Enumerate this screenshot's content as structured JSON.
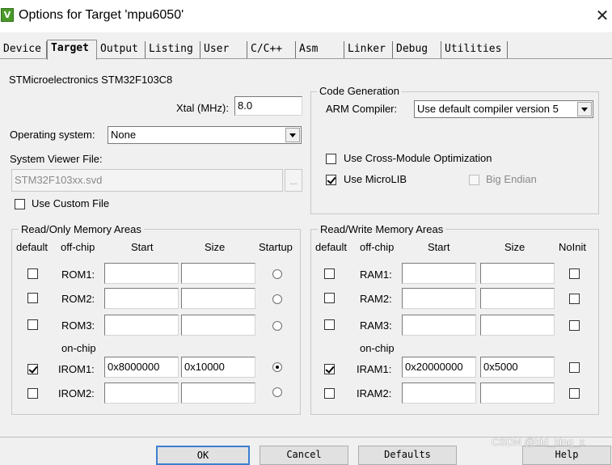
{
  "window": {
    "title": "Options for Target 'mpu6050'",
    "icon_name": "uvision-app-icon",
    "icon_glyph": "V"
  },
  "tabs": [
    {
      "label": "Device"
    },
    {
      "label": "Target"
    },
    {
      "label": "Output"
    },
    {
      "label": "Listing"
    },
    {
      "label": "User"
    },
    {
      "label": "C/C++"
    },
    {
      "label": "Asm"
    },
    {
      "label": "Linker"
    },
    {
      "label": "Debug"
    },
    {
      "label": "Utilities"
    }
  ],
  "active_tab": "Target",
  "target": {
    "device_name": "STMicroelectronics STM32F103C8",
    "xtal_label": "Xtal (MHz):",
    "xtal_value": "8.0",
    "os_label": "Operating system:",
    "os_value": "None",
    "svd_label": "System Viewer File:",
    "svd_value": "STM32F103xx.svd",
    "svd_browse": "...",
    "use_custom_file_label": "Use Custom File",
    "use_custom_file_checked": false
  },
  "code_generation": {
    "title": "Code Generation",
    "compiler_label": "ARM Compiler:",
    "compiler_value": "Use default compiler version 5",
    "cross_module_label": "Use Cross-Module Optimization",
    "cross_module_checked": false,
    "microlib_label": "Use MicroLIB",
    "microlib_checked": true,
    "big_endian_label": "Big Endian",
    "big_endian_checked": false
  },
  "ro_memory": {
    "title": "Read/Only Memory Areas",
    "headers": {
      "default": "default",
      "offchip": "off-chip",
      "start": "Start",
      "size": "Size",
      "last": "Startup"
    },
    "onchip_label": "on-chip",
    "rows": [
      {
        "name": "ROM1:",
        "default": false,
        "start": "",
        "size": "",
        "startup": false
      },
      {
        "name": "ROM2:",
        "default": false,
        "start": "",
        "size": "",
        "startup": false
      },
      {
        "name": "ROM3:",
        "default": false,
        "start": "",
        "size": "",
        "startup": false
      },
      {
        "name": "IROM1:",
        "default": true,
        "start": "0x8000000",
        "size": "0x10000",
        "startup": true
      },
      {
        "name": "IROM2:",
        "default": false,
        "start": "",
        "size": "",
        "startup": false
      }
    ]
  },
  "rw_memory": {
    "title": "Read/Write Memory Areas",
    "headers": {
      "default": "default",
      "offchip": "off-chip",
      "start": "Start",
      "size": "Size",
      "last": "NoInit"
    },
    "onchip_label": "on-chip",
    "rows": [
      {
        "name": "RAM1:",
        "default": false,
        "start": "",
        "size": "",
        "noinit": false
      },
      {
        "name": "RAM2:",
        "default": false,
        "start": "",
        "size": "",
        "noinit": false
      },
      {
        "name": "RAM3:",
        "default": false,
        "start": "",
        "size": "",
        "noinit": false
      },
      {
        "name": "IRAM1:",
        "default": true,
        "start": "0x20000000",
        "size": "0x5000",
        "noinit": false
      },
      {
        "name": "IRAM2:",
        "default": false,
        "start": "",
        "size": "",
        "noinit": false
      }
    ]
  },
  "buttons": {
    "ok": "OK",
    "cancel": "Cancel",
    "defaults": "Defaults",
    "help": "Help"
  },
  "watermark": "CSDN @kid_king_x"
}
